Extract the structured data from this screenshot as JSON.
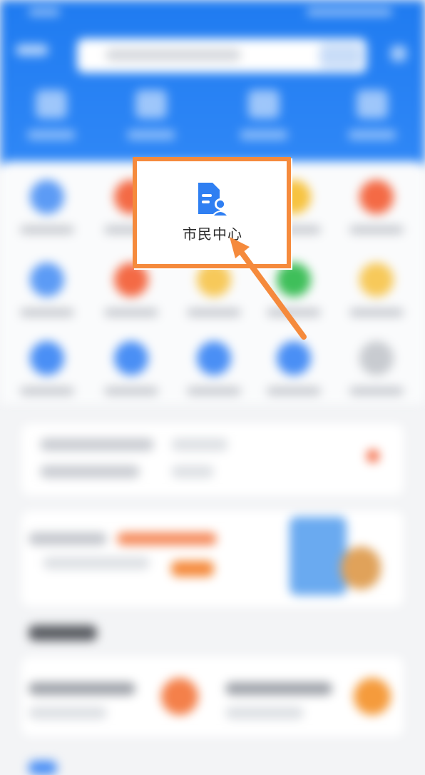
{
  "highlight": {
    "service_label": "市民中心",
    "service_icon": "citizen-document-icon"
  },
  "colors": {
    "header_blue": "#1f7bf0",
    "highlight_orange": "#f58a3c",
    "icon_blue": "#2f7ff2"
  }
}
